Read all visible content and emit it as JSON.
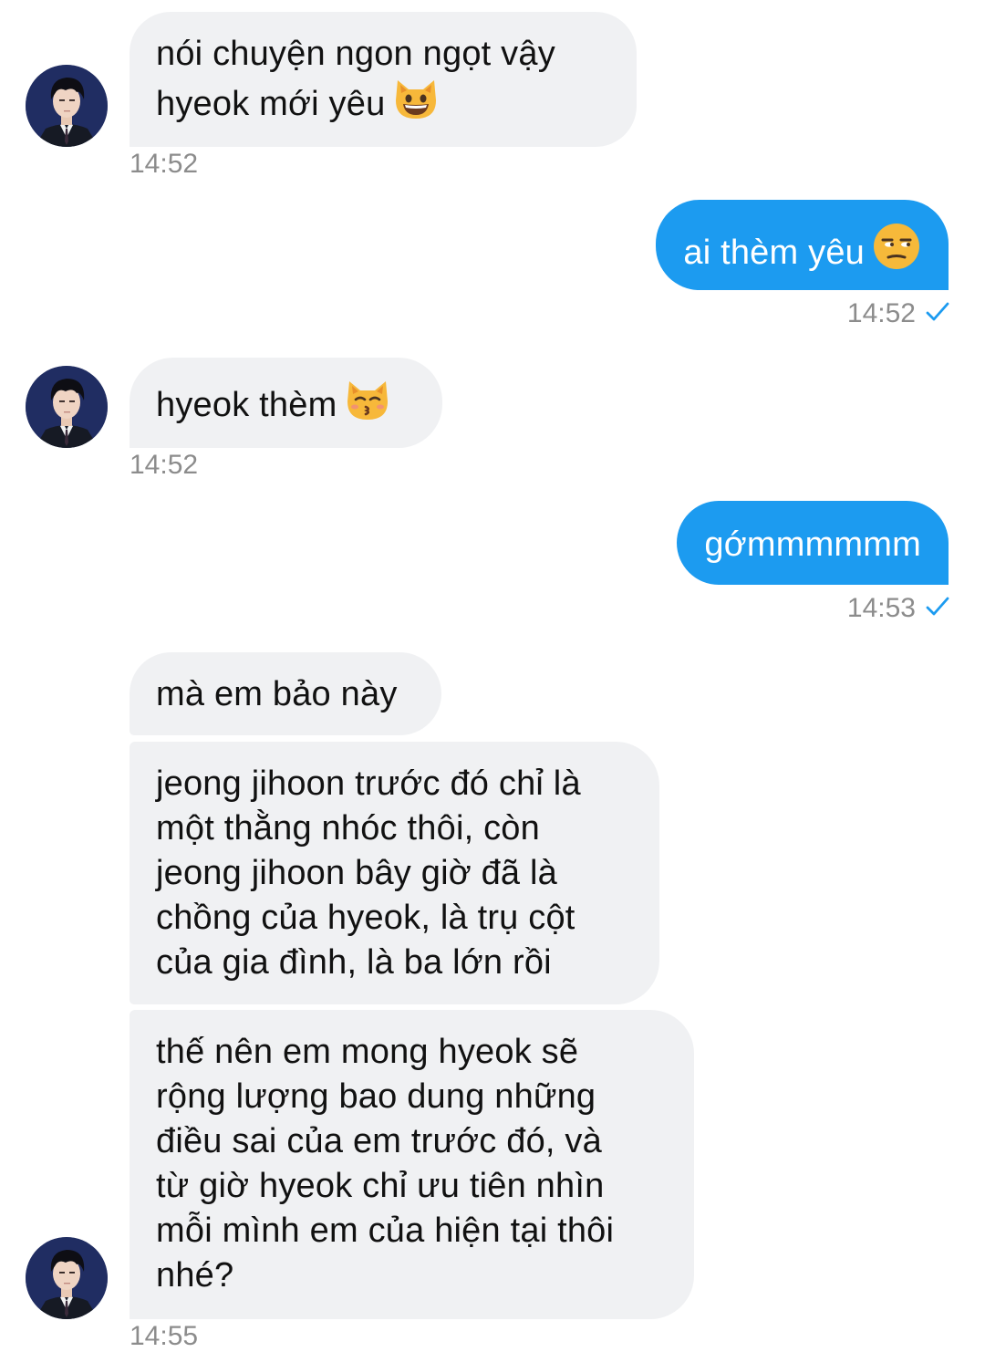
{
  "colors": {
    "incoming_bubble": "#f0f1f3",
    "outgoing_bubble": "#1c9bf0",
    "timestamp": "#8c8c8c",
    "read_check": "#1c9bf0"
  },
  "messages": [
    {
      "direction": "incoming",
      "text": "nói chuyện ngon ngọt vậy\nhyeok mới yêu",
      "emoji": "grinning-cat-icon",
      "time": "14:52"
    },
    {
      "direction": "outgoing",
      "text": "ai thèm yêu",
      "emoji": "unamused-face-icon",
      "time": "14:52",
      "status": "read-check-icon"
    },
    {
      "direction": "incoming",
      "text": "hyeok thèm",
      "emoji": "kissing-cat-icon",
      "time": "14:52"
    },
    {
      "direction": "outgoing",
      "text": "gớmmmmmm",
      "time": "14:53",
      "status": "read-check-icon"
    },
    {
      "direction": "incoming",
      "text": "mà em bảo này"
    },
    {
      "direction": "incoming",
      "text": "jeong jihoon trước đó chỉ là\nmột thằng nhóc thôi, còn\njeong jihoon bây giờ đã là\nchồng của hyeok, là trụ cột\ncủa gia đình, là ba lớn rồi"
    },
    {
      "direction": "incoming",
      "text": "thế nên em mong hyeok sẽ\nrộng lượng bao dung những\nđiều sai của em trước đó, và\ntừ giờ hyeok chỉ ưu tiên nhìn\nmỗi mình em của hiện tại thôi\nnhé?",
      "time": "14:55"
    }
  ]
}
